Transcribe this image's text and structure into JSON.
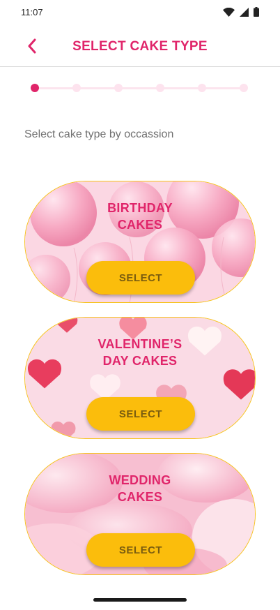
{
  "status_bar": {
    "time": "11:07",
    "icons": [
      "wifi-icon",
      "signal-icon",
      "battery-icon"
    ]
  },
  "header": {
    "title": "SELECT CAKE TYPE",
    "back_icon": "chevron-left-icon"
  },
  "stepper": {
    "total_steps": 6,
    "current_step": 1
  },
  "subtitle": "Select cake type by occassion",
  "cards": [
    {
      "title_line1": "BIRTHDAY",
      "title_line2": "CAKES",
      "button_label": "SELECT",
      "background": "pink balloons"
    },
    {
      "title_line1": "VALENTINE’S",
      "title_line2": "DAY CAKES",
      "button_label": "SELECT",
      "background": "pink hearts"
    },
    {
      "title_line1": "WEDDING",
      "title_line2": "CAKES",
      "button_label": "SELECT",
      "background": "pink rose petals"
    }
  ],
  "colors": {
    "accent": "#e0256a",
    "button": "#fbbd0c",
    "card_border": "#f6c21b"
  }
}
